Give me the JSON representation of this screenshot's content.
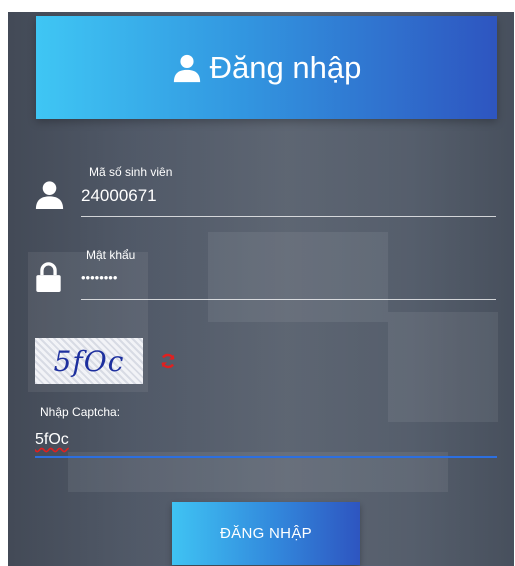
{
  "header": {
    "title": "Đăng nhập",
    "icon": "user-icon"
  },
  "student_id": {
    "label": "Mã số sinh viên",
    "value": "24000671",
    "icon": "user-icon"
  },
  "password": {
    "label": "Mật khẩu",
    "value": "••••••••",
    "icon": "lock-icon"
  },
  "captcha": {
    "image_text": "5fOc",
    "refresh_icon": "refresh-icon",
    "refresh_color": "#e02020",
    "input_label": "Nhập Captcha:",
    "input_value": "5fOc"
  },
  "submit": {
    "label": "ĐĂNG NHẬP"
  },
  "colors": {
    "accent_start": "#3fc6f4",
    "accent_end": "#2e55c0",
    "focus_line": "#2c6fe0"
  }
}
